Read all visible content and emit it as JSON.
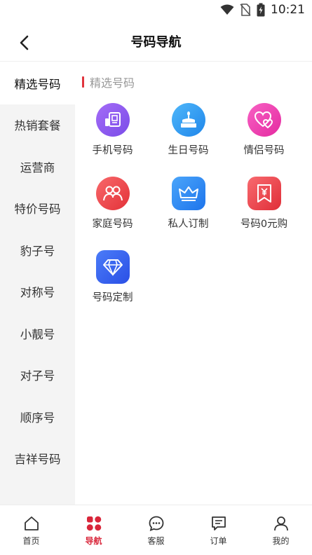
{
  "status_bar": {
    "time": "10:21"
  },
  "header": {
    "title": "号码导航"
  },
  "sidebar": {
    "items": [
      {
        "label": "精选号码"
      },
      {
        "label": "热销套餐"
      },
      {
        "label": "运营商"
      },
      {
        "label": "特价号码"
      },
      {
        "label": "豹子号"
      },
      {
        "label": "对称号"
      },
      {
        "label": "小靓号"
      },
      {
        "label": "对子号"
      },
      {
        "label": "顺序号"
      },
      {
        "label": "吉祥号码"
      }
    ],
    "active_index": 0
  },
  "main": {
    "section_title": "精选号码",
    "grid": [
      {
        "label": "手机号码",
        "icon": "phone-number-icon",
        "color": "#8f5cf2"
      },
      {
        "label": "生日号码",
        "icon": "birthday-cake-icon",
        "color": "#2e9cf3"
      },
      {
        "label": "情侣号码",
        "icon": "hearts-icon",
        "color": "#f03fb0"
      },
      {
        "label": "家庭号码",
        "icon": "family-icon",
        "color": "#f0474d"
      },
      {
        "label": "私人订制",
        "icon": "crown-icon",
        "color": "#2f8af5"
      },
      {
        "label": "号码0元购",
        "icon": "yuan-ticket-icon",
        "color": "#f0434a"
      },
      {
        "label": "号码定制",
        "icon": "diamond-icon",
        "color": "#3a63f2"
      }
    ]
  },
  "tabbar": {
    "items": [
      {
        "label": "首页",
        "icon": "home-icon"
      },
      {
        "label": "导航",
        "icon": "nav-grid-icon"
      },
      {
        "label": "客服",
        "icon": "chat-icon"
      },
      {
        "label": "订单",
        "icon": "order-icon"
      },
      {
        "label": "我的",
        "icon": "profile-icon"
      }
    ],
    "active_index": 1,
    "active_color": "#d9263a"
  },
  "colors": {
    "accent": "#e0343d",
    "sidebar_bg": "#f4f4f4"
  }
}
